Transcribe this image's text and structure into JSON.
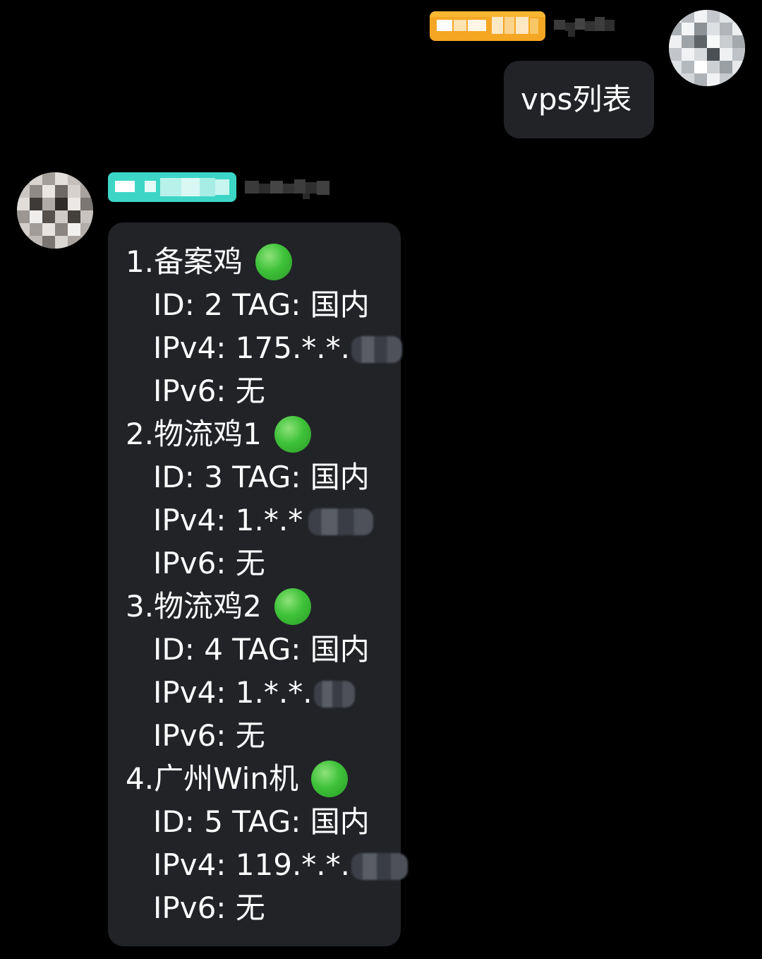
{
  "chat": {
    "outgoing": {
      "text": "vps列表"
    },
    "incoming": {
      "servers": [
        {
          "title": "1.备案鸡",
          "status_icon": "green-circle",
          "id_line": "ID: 2 TAG: 国内",
          "ipv4_line": "IPv4: 175.*.*.",
          "ipv6_line": "IPv6: 无"
        },
        {
          "title": "2.物流鸡1",
          "status_icon": "green-circle",
          "id_line": "ID: 3 TAG: 国内",
          "ipv4_line": "IPv4: 1.*.*",
          "ipv6_line": "IPv6: 无"
        },
        {
          "title": "3.物流鸡2",
          "status_icon": "green-circle",
          "id_line": "ID: 4 TAG: 国内",
          "ipv4_line": "IPv4: 1.*.*.",
          "ipv6_line": "IPv6: 无"
        },
        {
          "title": "4.广州Win机",
          "status_icon": "green-circle",
          "id_line": "ID: 5 TAG: 国内",
          "ipv4_line": "IPv4: 119.*.*.",
          "ipv6_line": "IPv6: 无"
        }
      ]
    }
  },
  "colors": {
    "background": "#000000",
    "bubble": "#212327",
    "self_tag": "#f5a623",
    "peer_tag": "#3dd6c6",
    "status_green": "#3fc23a"
  }
}
